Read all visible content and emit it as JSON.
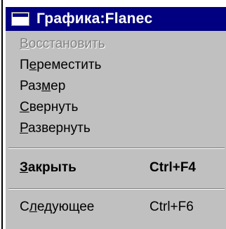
{
  "menu": {
    "title": "Графика:Flanec",
    "icon": "window-icon",
    "colors": {
      "title_bar": "#000080",
      "menu_bg": "#c0c0c0",
      "disabled_text": "#808080"
    },
    "items": [
      {
        "pre": "",
        "key": "В",
        "post": "осстановить",
        "shortcut": "",
        "enabled": false,
        "bold": false
      },
      {
        "pre": "П",
        "key": "е",
        "post": "реместить",
        "shortcut": "",
        "enabled": true,
        "bold": false
      },
      {
        "pre": "Раз",
        "key": "м",
        "post": "ер",
        "shortcut": "",
        "enabled": true,
        "bold": false
      },
      {
        "pre": "",
        "key": "С",
        "post": "вернуть",
        "shortcut": "",
        "enabled": true,
        "bold": false
      },
      {
        "pre": "",
        "key": "Р",
        "post": "азвернуть",
        "shortcut": "",
        "enabled": true,
        "bold": false
      },
      {
        "pre": "",
        "key": "З",
        "post": "акрыть",
        "shortcut": "Ctrl+F4",
        "enabled": true,
        "bold": true
      },
      {
        "pre": "С",
        "key": "л",
        "post": "едующее",
        "shortcut": "Ctrl+F6",
        "enabled": true,
        "bold": false
      }
    ]
  }
}
